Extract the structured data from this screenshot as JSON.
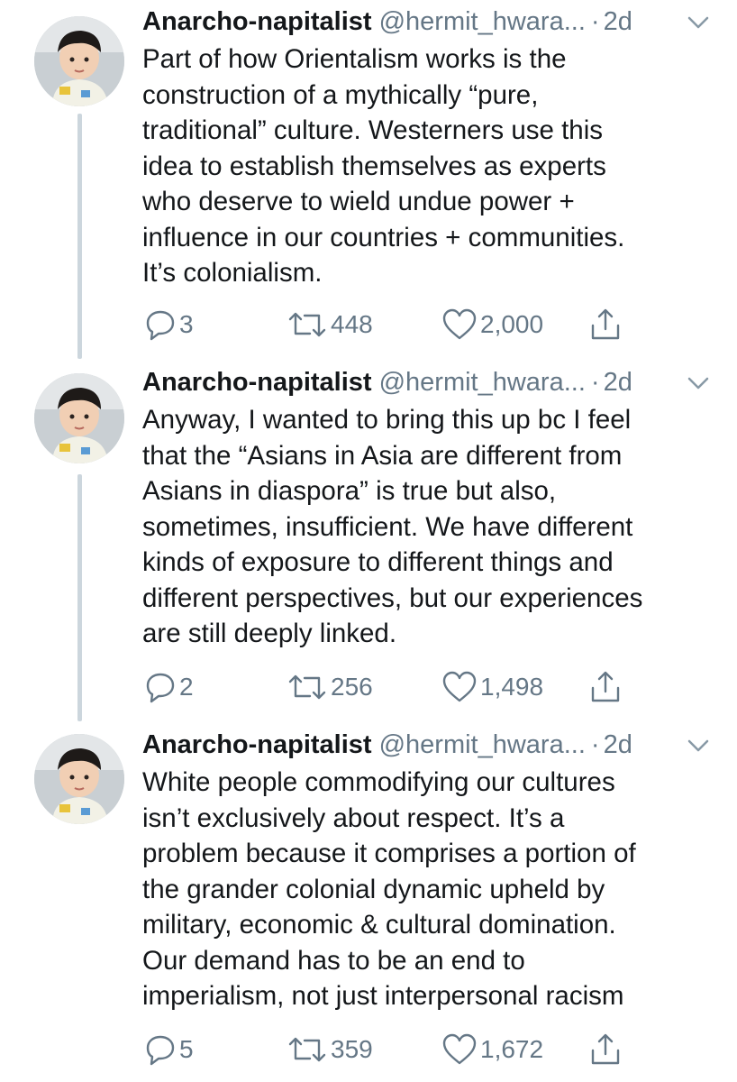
{
  "tweets": [
    {
      "name": "Anarcho-napitalist",
      "handle": "@hermit_hwara...",
      "separator": "·",
      "time": "2d",
      "lines": [
        "Part of how Orientalism works is the",
        "construction of a mythically “pure,",
        "traditional” culture. Westerners use this",
        "idea to establish themselves as experts",
        "who deserve to wield undue power +",
        "influence in our countries + communities.",
        "It’s colonialism."
      ],
      "replies": "3",
      "retweets": "448",
      "likes": "2,000"
    },
    {
      "name": "Anarcho-napitalist",
      "handle": "@hermit_hwara...",
      "separator": "·",
      "time": "2d",
      "lines": [
        "Anyway, I wanted to bring this up bc I feel",
        "that the “Asians in Asia are different from",
        "Asians in diaspora” is true but also,",
        "sometimes, insufficient. We have different",
        "kinds of exposure to different things and",
        "different perspectives, but our experiences",
        "are still deeply linked."
      ],
      "replies": "2",
      "retweets": "256",
      "likes": "1,498"
    },
    {
      "name": "Anarcho-napitalist",
      "handle": "@hermit_hwara...",
      "separator": "·",
      "time": "2d",
      "lines": [
        "White people commodifying our cultures",
        "isn’t exclusively about respect. It’s a",
        "problem because it comprises a portion of",
        "the grander colonial dynamic upheld by",
        "military, economic & cultural domination.",
        "Our demand has to be an end to",
        "imperialism, not just interpersonal racism"
      ],
      "replies": "5",
      "retweets": "359",
      "likes": "1,672"
    }
  ],
  "icons": {
    "reply": "reply-icon",
    "retweet": "retweet-icon",
    "like": "heart-icon",
    "share": "share-icon",
    "caret": "chevron-down-icon"
  },
  "colors": {
    "text": "#14171a",
    "secondary": "#657786",
    "thread_line": "#ccd6dd"
  }
}
